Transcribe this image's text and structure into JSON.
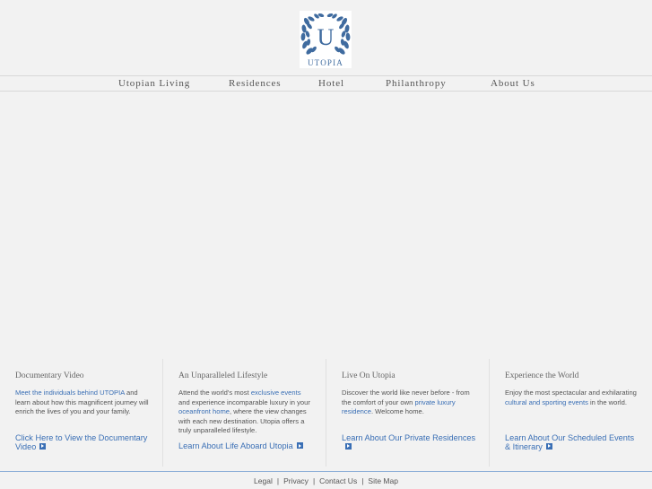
{
  "brand": {
    "name": "UTOPIA",
    "letter": "U",
    "logo_color": "#3f6b9f"
  },
  "nav": {
    "items": [
      {
        "label": "Utopian Living"
      },
      {
        "label": "Residences"
      },
      {
        "label": "Hotel"
      },
      {
        "label": "Philanthropy"
      },
      {
        "label": "About Us"
      }
    ]
  },
  "panels": [
    {
      "title": "Documentary Video",
      "text_link": "Meet the individuals behind UTOPIA",
      "text": " and learn about how this magnificent journey will enrich the lives of you and your family.",
      "cta": "Click Here to View the Documentary Video"
    },
    {
      "title": "An Unparalleled Lifestyle",
      "text_1": "Attend the world's most ",
      "link_1": "exclusive events",
      "text_2": " and experience incomparable luxury in your ",
      "link_2": "oceanfront home",
      "text_3": ", where the view changes with each new destination. Utopia offers a truly unparalleled lifestyle.",
      "cta": "Learn About Life Aboard Utopia"
    },
    {
      "title": "Live On Utopia",
      "text_1": "Discover the world like never before - from the comfort of your own ",
      "link_1": "private luxury residence",
      "text_2": ". Welcome home.",
      "cta": "Learn About Our Private Residences"
    },
    {
      "title": "Experience the World",
      "text_1": "Enjoy the most spectacular and exhilarating ",
      "link_1": "cultural and sporting events",
      "text_2": " in the world.",
      "cta": "Learn About Our Scheduled Events & Itinerary"
    }
  ],
  "footer": {
    "links": [
      "Legal",
      "Privacy",
      "Contact Us",
      "Site Map"
    ],
    "separator": "|"
  },
  "colors": {
    "link": "#3a6fb5",
    "background": "#f2f2f2",
    "text": "#555555"
  }
}
